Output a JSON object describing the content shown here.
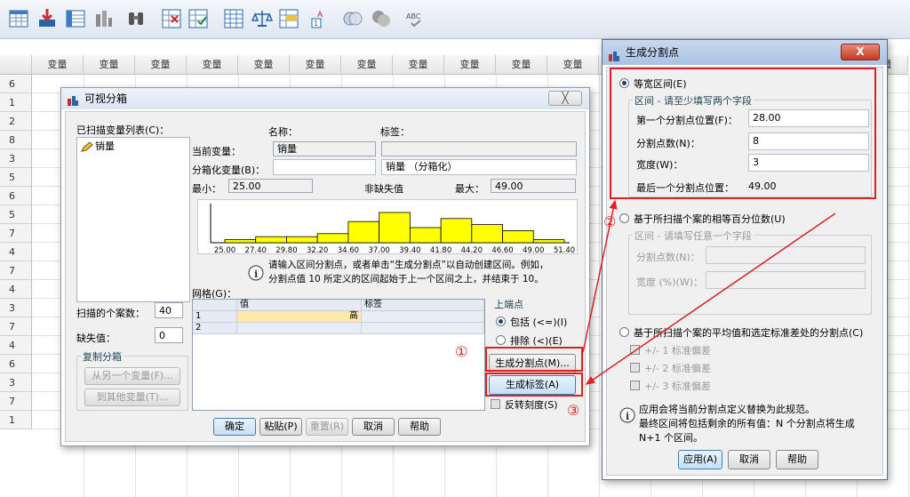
{
  "grid": {
    "col_header": "变量",
    "col_header_partial": "变量",
    "row_numbers": [
      "6",
      "1",
      "2",
      "8",
      "3",
      "5",
      "6",
      "5",
      "7",
      "4",
      "7",
      "4",
      "3",
      "7",
      "4",
      "6",
      "3",
      "7",
      "1"
    ]
  },
  "visual_binning": {
    "title": "可视分箱",
    "scanned_list_label": "已扫描变量列表(C)：",
    "scanned_item": "销量",
    "name_header": "名称：",
    "label_header": "标签：",
    "current_var_label": "当前变量：",
    "current_var_name": "销量",
    "current_var_label_value": "",
    "binned_var_label": "分箱化变量(B)：",
    "binned_var_name": "",
    "binned_var_label_value": "销量 （分箱化）",
    "min_label": "最小：",
    "min_value": "25.00",
    "nonmissing_label": "非缺失值",
    "max_label": "最大：",
    "max_value": "49.00",
    "axis_ticks": [
      "25.00",
      "27.40",
      "29.80",
      "32.20",
      "34.60",
      "37.00",
      "39.40",
      "41.80",
      "44.20",
      "46.60",
      "49.00",
      "51.40"
    ],
    "info_text_1": "请输入区间分割点，或者单击“生成分割点”以自动创建区间。例如，",
    "info_text_2": "分割点值 10 所定义的区间起始于上一个区间之上，并结束于 10。",
    "grid_label": "网格(G)：",
    "grid_col_value": "值",
    "grid_col_label": "标签",
    "grid_rows": [
      {
        "n": "1",
        "value": "高",
        "label": ""
      },
      {
        "n": "2",
        "value": "",
        "label": ""
      }
    ],
    "endpoint_title": "上端点",
    "endpoint_include": "包括 (<=)(I)",
    "endpoint_exclude": "排除 (<)(E)",
    "make_cutpoints": "生成分割点(M)...",
    "make_labels": "生成标签(A)",
    "reverse_scale": "反转刻度(S)",
    "cases_scanned_label": "扫描的个案数：",
    "cases_scanned_value": "40",
    "missing_label": "缺失值：",
    "missing_value": "0",
    "copy_bins_title": "复制分箱",
    "from_another": "从另一个变量(F)...",
    "to_other": "到其他变量(T)...",
    "ok": "确定",
    "paste": "粘贴(P)",
    "reset": "重置(R)",
    "cancel": "取消",
    "help": "帮助"
  },
  "histogram": {
    "bars": [
      1,
      2,
      2,
      3,
      7,
      10,
      5,
      8,
      6,
      4,
      1
    ]
  },
  "make_cutpoints": {
    "title": "生成分割点",
    "equal_width": "等宽区间(E)",
    "interval_group": "区间 - 请至少填写两个字段",
    "first_cut_label": "第一个分割点位置(F)：",
    "first_cut_value": "28.00",
    "num_cuts_label": "分割点数(N)：",
    "num_cuts_value": "8",
    "width_label": "宽度(W)：",
    "width_value": "3",
    "last_cut_label": "最后一个分割点位置：",
    "last_cut_value": "49.00",
    "equal_percentile": "基于所扫描个案的相等百分位数(U)",
    "pct_group": "区间 - 请填写任意一个字段",
    "pct_num_cuts_label": "分割点数(N)：",
    "pct_width_label": "宽度 (%)(W)：",
    "mean_sd": "基于所扫描个案的平均值和选定标准差处的分割点(C)",
    "sd1": "+/- 1 标准偏差",
    "sd2": "+/- 2 标准偏差",
    "sd3": "+/- 3 标准偏差",
    "info_1": "应用会将当前分割点定义替换为此规范。",
    "info_2": "最终区间将包括剩余的所有值：N 个分割点将生成",
    "info_3": "N+1 个区间。",
    "apply": "应用(A)",
    "cancel": "取消",
    "help": "帮助",
    "close": "X"
  },
  "annotations": {
    "one": "①",
    "two": "②",
    "three": "③"
  },
  "colors": {
    "annotation_red": "#e02020",
    "bar_yellow": "#ffff00",
    "accent_blue": "#3c7fb1"
  }
}
